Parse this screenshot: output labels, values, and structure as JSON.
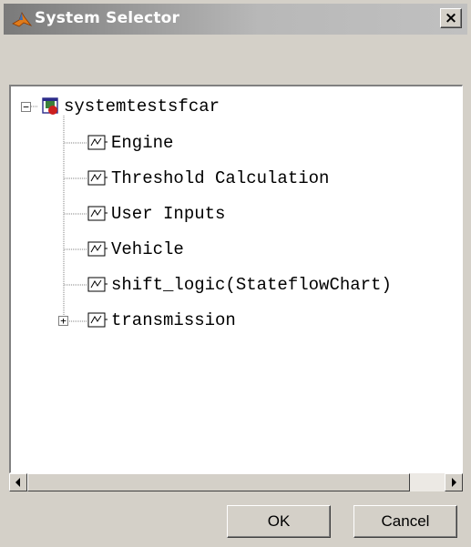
{
  "window": {
    "title": "System Selector",
    "close_label": "×"
  },
  "tree": {
    "root": {
      "label": "systemtestsfcar",
      "expander": "−",
      "expanded": true
    },
    "children": [
      {
        "label": "Engine",
        "icon": "subsystem-block-icon",
        "has_children": false
      },
      {
        "label": "Threshold Calculation",
        "icon": "subsystem-block-icon",
        "has_children": false
      },
      {
        "label": "User Inputs",
        "icon": "subsystem-block-icon",
        "has_children": false
      },
      {
        "label": "Vehicle",
        "icon": "subsystem-block-icon",
        "has_children": false
      },
      {
        "label": "shift_logic(StateflowChart)",
        "icon": "subsystem-block-icon",
        "has_children": false
      },
      {
        "label": "transmission",
        "icon": "subsystem-block-icon",
        "has_children": true,
        "expander": "+"
      }
    ]
  },
  "buttons": {
    "ok": "OK",
    "cancel": "Cancel"
  }
}
